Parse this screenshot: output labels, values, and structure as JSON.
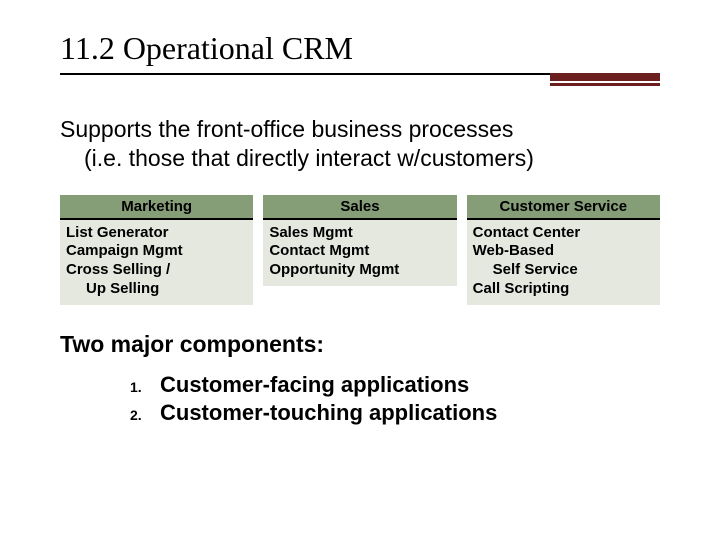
{
  "title_number": "11.2",
  "title_text": "Operational CRM",
  "lead_line1": "Supports the front-office business processes",
  "lead_line2": "(i.e. those that directly interact w/customers)",
  "columns": [
    {
      "header": "Marketing",
      "items": [
        "List Generator",
        "Campaign Mgmt",
        "Cross Selling /"
      ],
      "items_indent": [
        "Up Selling"
      ]
    },
    {
      "header": "Sales",
      "items": [
        "Sales Mgmt",
        "Contact Mgmt",
        "Opportunity Mgmt"
      ],
      "items_indent": []
    },
    {
      "header": "Customer Service",
      "items": [
        "Contact Center",
        "Web-Based"
      ],
      "items_indent": [
        "Self Service"
      ],
      "items_after": [
        "Call Scripting"
      ]
    }
  ],
  "subhead": "Two major components:",
  "components": [
    "Customer-facing applications",
    "Customer-touching applications"
  ]
}
